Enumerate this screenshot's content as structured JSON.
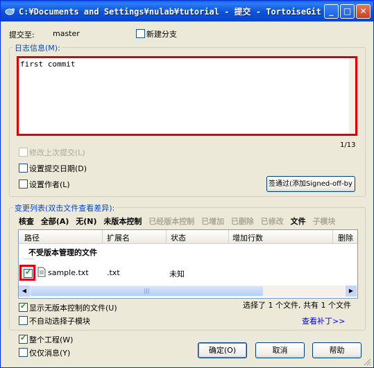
{
  "window": {
    "title": "C:¥Documents and Settings¥nulab¥tutorial - 提交 - TortoiseGit",
    "minimize": "_",
    "maximize": "□",
    "close": "✕"
  },
  "commit_to": {
    "label": "提交至:",
    "branch": "master",
    "new_branch_label": "新建分支"
  },
  "log_message": {
    "label": "日志信息(M):",
    "text": "first commit",
    "counter": "1/13",
    "amend_label": "修改上次提交(L)",
    "set_date_label": "设置提交日期(D)",
    "set_author_label": "设置作者(L)",
    "signoff_label": "签通过(添加Signed-off-by"
  },
  "changes": {
    "label": "变更列表(双击文件查看差异):",
    "filters": [
      {
        "label": "核查",
        "enabled": true
      },
      {
        "label": "全部(A)",
        "enabled": true
      },
      {
        "label": "无(N)",
        "enabled": true
      },
      {
        "label": "未版本控制",
        "enabled": true
      },
      {
        "label": "已经版本控制",
        "enabled": false
      },
      {
        "label": "已增加",
        "enabled": false
      },
      {
        "label": "已删除",
        "enabled": false
      },
      {
        "label": "已修改",
        "enabled": false
      },
      {
        "label": "文件",
        "enabled": true
      },
      {
        "label": "子模块",
        "enabled": false
      }
    ],
    "columns": [
      "路径",
      "扩展名",
      "状态",
      "增加行数",
      "删除"
    ],
    "group_header": "不受版本管理的文件",
    "rows": [
      {
        "checked": true,
        "path": "sample.txt",
        "ext": ".txt",
        "status": "未知"
      }
    ],
    "show_unversioned_label": "显示无版本控制的文件(U)",
    "no_auto_submodule_label": "不自动选择子模块",
    "summary": "选择了 1 个文件, 共有 1 个文件",
    "view_patch": "查看补丁>>"
  },
  "footer": {
    "whole_project_label": "整个工程(W)",
    "message_only_label": "仅仅消息(Y)",
    "ok": "确定(O)",
    "cancel": "取消",
    "help": "帮助"
  },
  "colors": {
    "highlight": "#e00000",
    "link": "#0000ff",
    "titlebar": "#0a53d9"
  }
}
